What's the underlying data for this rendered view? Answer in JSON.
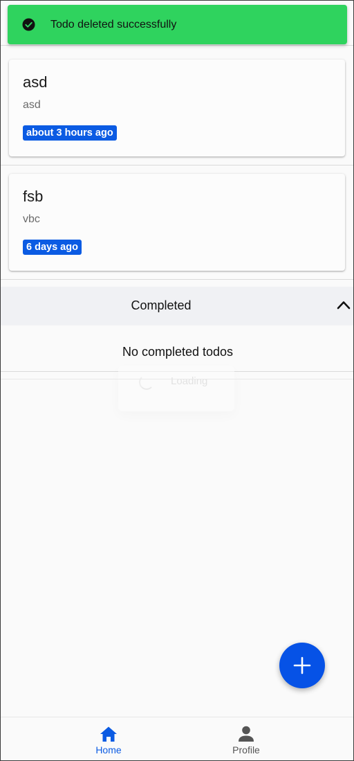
{
  "toast": {
    "message": "Todo deleted successfully",
    "icon": "check-circle-icon",
    "color": "#2fd35e"
  },
  "todos": [
    {
      "title": "asd",
      "description": "asd",
      "time_badge": "about 3 hours ago"
    },
    {
      "title": "fsb",
      "description": "vbc",
      "time_badge": "6 days ago"
    }
  ],
  "completed_section": {
    "title": "Completed",
    "toggle_icon": "chevron-up-icon",
    "empty_message": "No completed todos"
  },
  "loading": {
    "label": "Loading"
  },
  "fab": {
    "icon": "plus-icon",
    "color": "#0652e6"
  },
  "bottom_nav": {
    "items": [
      {
        "label": "Home",
        "icon": "home-icon",
        "active": true
      },
      {
        "label": "Profile",
        "icon": "person-icon",
        "active": false
      }
    ]
  },
  "colors": {
    "accent": "#0b5be3",
    "background": "#fafafa"
  }
}
